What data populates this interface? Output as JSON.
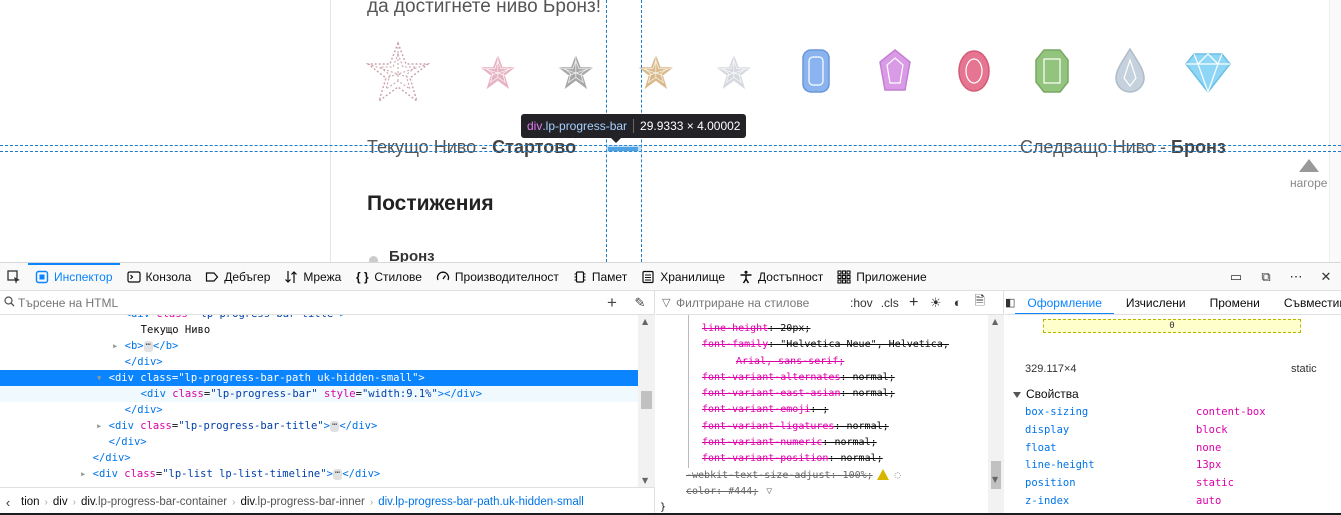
{
  "page": {
    "intro_text": "да достигнете ниво Бронз!",
    "badges": [
      {
        "name": "star-outline-icon",
        "color": "#c9a0a8"
      },
      {
        "name": "star-pink-icon",
        "color": "#e6b3c2"
      },
      {
        "name": "star-gray-icon",
        "color": "#a8a8a8"
      },
      {
        "name": "star-gold-icon",
        "color": "#d9b98a"
      },
      {
        "name": "star-silver-icon",
        "color": "#d5d8de"
      },
      {
        "name": "gem-blue-icon",
        "color": "#8ab4f0"
      },
      {
        "name": "gem-purple-icon",
        "color": "#d99be6"
      },
      {
        "name": "gem-ruby-icon",
        "color": "#e57590"
      },
      {
        "name": "gem-green-icon",
        "color": "#93c47d"
      },
      {
        "name": "gem-drop-icon",
        "color": "#c5d1dc"
      },
      {
        "name": "gem-diamond-icon",
        "color": "#8ed6f5"
      }
    ],
    "current_level_label": "Текущо Ниво - ",
    "current_level_value": "Стартово",
    "next_level_label": "Следващо Ниво - ",
    "next_level_value": "Бронз",
    "to_top": "нагоре",
    "section_title": "Постижения",
    "first_item": "Бронз",
    "progress_percent": 9.1
  },
  "highlighter": {
    "tag": "div",
    "class": ".lp-progress-bar",
    "dimensions": "29.9333 × 4.00002"
  },
  "toolbar": {
    "tools": [
      {
        "key": "inspector",
        "label": "Инспектор",
        "icon": "inspector-icon",
        "active": true
      },
      {
        "key": "console",
        "label": "Конзола",
        "icon": "console-icon"
      },
      {
        "key": "debugger",
        "label": "Дебъгер",
        "icon": "debugger-icon"
      },
      {
        "key": "network",
        "label": "Мрежа",
        "icon": "network-icon"
      },
      {
        "key": "styles",
        "label": "Стилове",
        "icon": "styles-icon"
      },
      {
        "key": "performance",
        "label": "Производителност",
        "icon": "performance-icon"
      },
      {
        "key": "memory",
        "label": "Памет",
        "icon": "memory-icon"
      },
      {
        "key": "storage",
        "label": "Хранилище",
        "icon": "storage-icon"
      },
      {
        "key": "accessibility",
        "label": "Достъпност",
        "icon": "accessibility-icon"
      },
      {
        "key": "application",
        "label": "Приложение",
        "icon": "application-icon"
      }
    ]
  },
  "markup": {
    "search_placeholder": "Търсене на HTML",
    "nodes": [
      {
        "indent": 8,
        "t": "partial",
        "text": "<div class=\"lp-progress-bar-title\">"
      },
      {
        "indent": 9,
        "t": "text",
        "text": "Текущо Ниво"
      },
      {
        "indent": 8,
        "t": "b",
        "text": "<b>"
      },
      {
        "indent": 8,
        "t": "close",
        "text": "</div>"
      },
      {
        "indent": 7,
        "t": "selected",
        "tag": "div",
        "attr": "class",
        "val": "lp-progress-bar-path uk-hidden-small"
      },
      {
        "indent": 9,
        "t": "child",
        "tag": "div",
        "attr": "class",
        "val": "lp-progress-bar",
        "attr2": "style",
        "val2": "width:9.1%"
      },
      {
        "indent": 8,
        "t": "close",
        "text": "</div>"
      },
      {
        "indent": 7,
        "t": "collapsed",
        "tag": "div",
        "attr": "class",
        "val": "lp-progress-bar-title"
      },
      {
        "indent": 7,
        "t": "close",
        "text": "</div>"
      },
      {
        "indent": 6,
        "t": "close",
        "text": "</div>"
      },
      {
        "indent": 6,
        "t": "collapsed",
        "tag": "div",
        "attr": "class",
        "val": "lp-list lp-list-timeline"
      }
    ],
    "breadcrumbs": [
      {
        "tag": "tion",
        "cls": "",
        "faded": true
      },
      {
        "tag": "div",
        "cls": ""
      },
      {
        "tag": "div",
        "cls": ".lp-progress-bar-container"
      },
      {
        "tag": "div",
        "cls": ".lp-progress-bar-inner"
      },
      {
        "tag": "div",
        "cls": ".lp-progress-bar-path.uk-hidden-small",
        "last": true
      }
    ]
  },
  "rules": {
    "filter_placeholder": "Филтриране на стилове",
    "hov": ":hov",
    "cls": ".cls",
    "decls": [
      {
        "k": "line-height",
        "v": "20px;"
      },
      {
        "k": "font-family",
        "v": "\"Helvetica Neue\", Helvetica,"
      },
      {
        "k": "",
        "v": "Arial, sans-serif;",
        "wrap": true
      },
      {
        "k": "font-variant-alternates",
        "v": "normal;"
      },
      {
        "k": "font-variant-east-asian",
        "v": "normal;"
      },
      {
        "k": "font-variant-emoji",
        "v": ";"
      },
      {
        "k": "font-variant-ligatures",
        "v": "normal;"
      },
      {
        "k": "font-variant-numeric",
        "v": "normal;"
      },
      {
        "k": "font-variant-position",
        "v": "normal;"
      },
      {
        "k": "-webkit-text-size-adjust",
        "v": "100%;",
        "plain": true,
        "warn": true
      },
      {
        "k": "color",
        "v": "#444;",
        "plain": true,
        "filter": true
      }
    ],
    "close_brace": "}"
  },
  "sidebar": {
    "tabs": [
      "Оформление",
      "Изчислени",
      "Промени",
      "Съвместимост"
    ],
    "box_value": "0",
    "dimensions": "329.117×4",
    "position": "static",
    "properties_title": "Свойства",
    "properties": [
      {
        "k": "box-sizing",
        "v": "content-box"
      },
      {
        "k": "display",
        "v": "block"
      },
      {
        "k": "float",
        "v": "none"
      },
      {
        "k": "line-height",
        "v": "13px"
      },
      {
        "k": "position",
        "v": "static"
      },
      {
        "k": "z-index",
        "v": "auto"
      }
    ]
  }
}
